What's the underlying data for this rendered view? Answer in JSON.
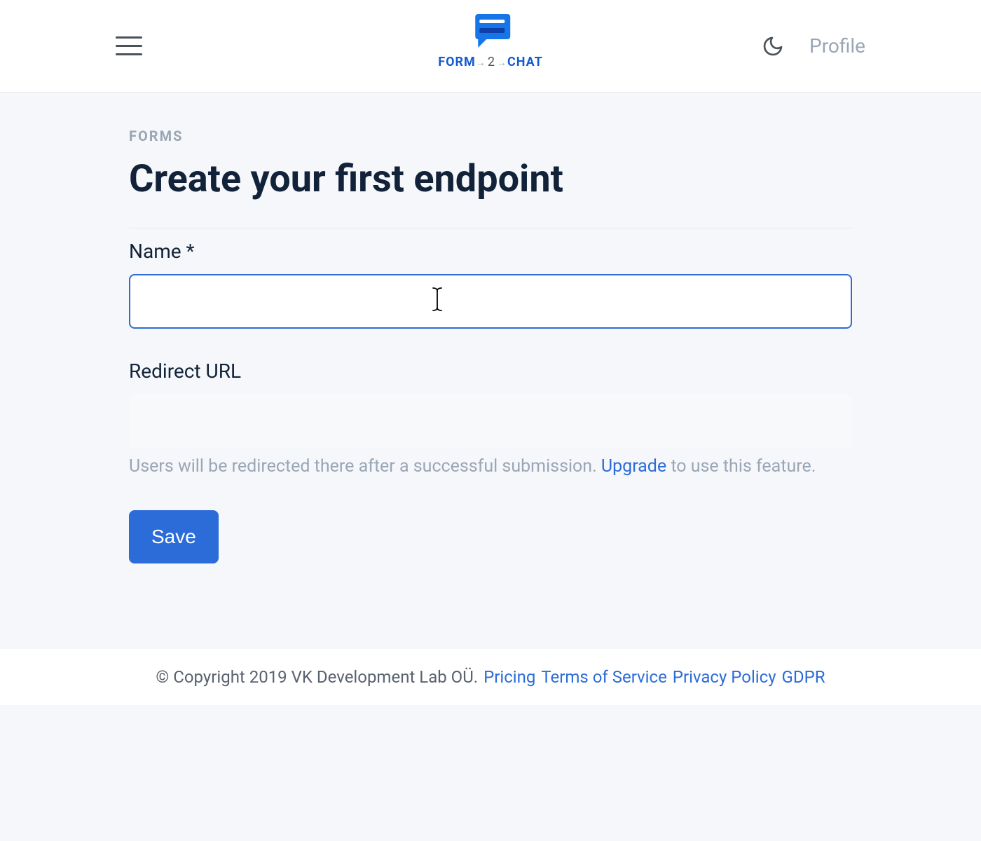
{
  "header": {
    "logo_form": "FORM",
    "logo_two": "2",
    "logo_chat": "CHAT",
    "profile_label": "Profile"
  },
  "main": {
    "eyebrow": "FORMS",
    "title": "Create your first endpoint",
    "name": {
      "label": "Name *",
      "value": ""
    },
    "redirect": {
      "label": "Redirect URL",
      "value": "",
      "helper_before": "Users will be redirected there after a successful submission. ",
      "upgrade_link": "Upgrade",
      "helper_after": " to use this feature."
    },
    "save_label": "Save"
  },
  "footer": {
    "copyright": "© Copyright 2019 VK Development Lab OÜ. ",
    "links": {
      "pricing": "Pricing",
      "tos": "Terms of Service",
      "privacy": "Privacy Policy",
      "gdpr": "GDPR"
    }
  }
}
